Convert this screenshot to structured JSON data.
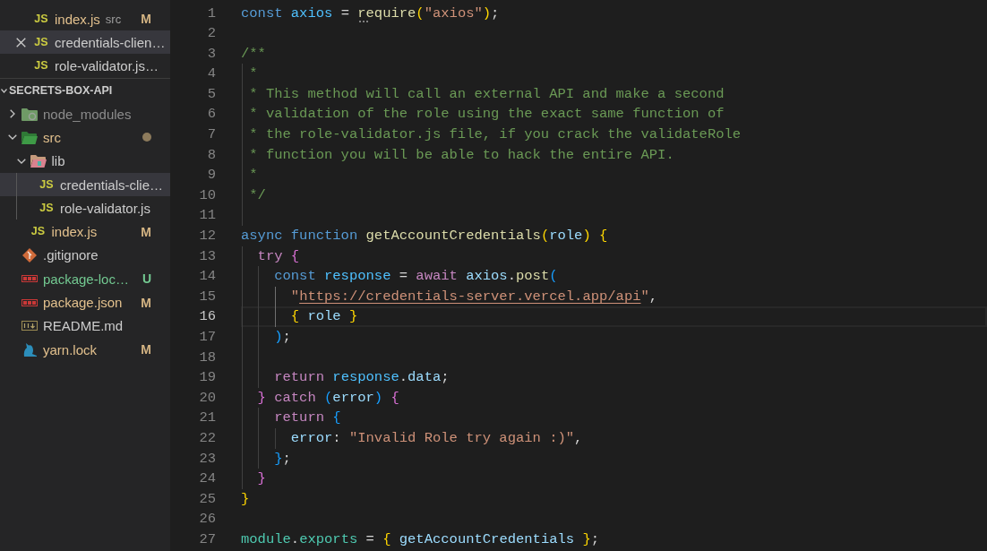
{
  "open_editors": [
    {
      "name": "index.js",
      "description": "src",
      "kind": "script",
      "icon_text": "JS",
      "selected": false,
      "decoration": {
        "kind": "modified",
        "badge": "M"
      }
    },
    {
      "name": "credentials-clien…",
      "kind": "script",
      "icon_text": "JS",
      "selected": true
    },
    {
      "name": "role-validator.js…",
      "kind": "script",
      "icon_text": "JS",
      "selected": false
    }
  ],
  "explorer": {
    "title": "SECRETS-BOX-API",
    "expanded": true,
    "items": [
      {
        "name": "node_modules",
        "kind": "modules",
        "expanded": false,
        "selected": false,
        "decoration": {
          "kind": "ignored"
        }
      },
      {
        "name": "src",
        "kind": "source",
        "expanded": true,
        "selected": false,
        "decoration": {
          "kind": "nested"
        },
        "children": [
          {
            "name": "lib",
            "kind": "library",
            "expanded": true,
            "selected": false,
            "children": [
              {
                "name": "credentials-clie…",
                "kind": "script",
                "icon_text": "JS",
                "selected": true
              },
              {
                "name": "role-validator.js",
                "kind": "script",
                "icon_text": "JS",
                "selected": false
              }
            ]
          },
          {
            "name": "index.js",
            "kind": "script",
            "icon_text": "JS",
            "selected": false,
            "decoration": {
              "kind": "modified",
              "badge": "M"
            }
          }
        ]
      },
      {
        "name": ".gitignore",
        "kind": "git",
        "selected": false
      },
      {
        "name": "package-loc…",
        "kind": "npm",
        "selected": false,
        "decoration": {
          "kind": "untracked",
          "badge": "U"
        }
      },
      {
        "name": "package.json",
        "kind": "npm",
        "selected": false,
        "decoration": {
          "kind": "modified",
          "badge": "M"
        }
      },
      {
        "name": "README.md",
        "kind": "markdown",
        "selected": false
      },
      {
        "name": "yarn.lock",
        "kind": "yarn",
        "selected": false,
        "decoration": {
          "kind": "modified",
          "badge": "M"
        }
      }
    ]
  },
  "code": {
    "lines": [
      {
        "number": "1",
        "current": false,
        "tokens": [
          {
            "text": "const ",
            "kind": "keyword"
          },
          {
            "text": "axios",
            "kind": "constant"
          },
          {
            "text": " = ",
            "kind": "plain"
          },
          {
            "text": "require",
            "kind": "function",
            "hint": true
          },
          {
            "text": "(",
            "kind": "bracket1"
          },
          {
            "text": "\"axios\"",
            "kind": "string"
          },
          {
            "text": ")",
            "kind": "bracket1"
          },
          {
            "text": ";",
            "kind": "plain"
          }
        ]
      },
      {
        "number": "2",
        "current": false
      },
      {
        "number": "3",
        "current": false,
        "tokens": [
          {
            "text": "/**",
            "kind": "comment"
          }
        ]
      },
      {
        "number": "4",
        "current": false,
        "guides": [
          {
            "active": false
          }
        ],
        "tokens": [
          {
            "text": " *",
            "kind": "comment"
          }
        ]
      },
      {
        "number": "5",
        "current": false,
        "guides": [
          {
            "active": false
          }
        ],
        "tokens": [
          {
            "text": " * This method will call an external API and make a second",
            "kind": "comment"
          }
        ]
      },
      {
        "number": "6",
        "current": false,
        "guides": [
          {
            "active": false
          }
        ],
        "tokens": [
          {
            "text": " * validation of the role using the exact same function of",
            "kind": "comment"
          }
        ]
      },
      {
        "number": "7",
        "current": false,
        "guides": [
          {
            "active": false
          }
        ],
        "tokens": [
          {
            "text": " * the role-validator.js file, if you crack the validateRole",
            "kind": "comment"
          }
        ]
      },
      {
        "number": "8",
        "current": false,
        "guides": [
          {
            "active": false
          }
        ],
        "tokens": [
          {
            "text": " * function you will be able to hack the entire API.",
            "kind": "comment"
          }
        ]
      },
      {
        "number": "9",
        "current": false,
        "guides": [
          {
            "active": false
          }
        ],
        "tokens": [
          {
            "text": " *",
            "kind": "comment"
          }
        ]
      },
      {
        "number": "10",
        "current": false,
        "guides": [
          {
            "active": false
          }
        ],
        "tokens": [
          {
            "text": " */",
            "kind": "comment"
          }
        ]
      },
      {
        "number": "11",
        "current": false,
        "guides": [
          {
            "active": false
          }
        ]
      },
      {
        "number": "12",
        "current": false,
        "tokens": [
          {
            "text": "async ",
            "kind": "keyword"
          },
          {
            "text": "function ",
            "kind": "keyword"
          },
          {
            "text": "getAccountCredentials",
            "kind": "function"
          },
          {
            "text": "(",
            "kind": "bracket1"
          },
          {
            "text": "role",
            "kind": "variable"
          },
          {
            "text": ") ",
            "kind": "bracket1"
          },
          {
            "text": "{",
            "kind": "bracket1"
          }
        ]
      },
      {
        "number": "13",
        "current": false,
        "guides": [
          {
            "active": false
          }
        ],
        "tokens": [
          {
            "text": "  try ",
            "kind": "control"
          },
          {
            "text": "{",
            "kind": "bracket2"
          }
        ]
      },
      {
        "number": "14",
        "current": false,
        "guides": [
          {
            "active": false
          },
          {
            "active": false
          }
        ],
        "tokens": [
          {
            "text": "    const ",
            "kind": "keyword"
          },
          {
            "text": "response",
            "kind": "constant"
          },
          {
            "text": " = ",
            "kind": "plain"
          },
          {
            "text": "await ",
            "kind": "control"
          },
          {
            "text": "axios",
            "kind": "variable"
          },
          {
            "text": ".",
            "kind": "plain"
          },
          {
            "text": "post",
            "kind": "function"
          },
          {
            "text": "(",
            "kind": "bracket3"
          }
        ]
      },
      {
        "number": "15",
        "current": false,
        "guides": [
          {
            "active": false
          },
          {
            "active": false
          },
          {
            "active": true
          }
        ],
        "tokens": [
          {
            "text": "      \"",
            "kind": "string"
          },
          {
            "text": "https://credentials-server.vercel.app/api",
            "kind": "link"
          },
          {
            "text": "\"",
            "kind": "string"
          },
          {
            "text": ",",
            "kind": "plain"
          }
        ]
      },
      {
        "number": "16",
        "current": true,
        "guides": [
          {
            "active": false
          },
          {
            "active": false
          },
          {
            "active": true
          }
        ],
        "tokens": [
          {
            "text": "      { ",
            "kind": "bracket1"
          },
          {
            "text": "role ",
            "kind": "variable"
          },
          {
            "text": "}",
            "kind": "bracket1"
          }
        ]
      },
      {
        "number": "17",
        "current": false,
        "guides": [
          {
            "active": false
          },
          {
            "active": false
          }
        ],
        "tokens": [
          {
            "text": "    )",
            "kind": "bracket3"
          },
          {
            "text": ";",
            "kind": "plain"
          }
        ]
      },
      {
        "number": "18",
        "current": false,
        "guides": [
          {
            "active": false
          },
          {
            "active": false
          }
        ]
      },
      {
        "number": "19",
        "current": false,
        "guides": [
          {
            "active": false
          },
          {
            "active": false
          }
        ],
        "tokens": [
          {
            "text": "    return ",
            "kind": "control"
          },
          {
            "text": "response",
            "kind": "constant"
          },
          {
            "text": ".",
            "kind": "plain"
          },
          {
            "text": "data",
            "kind": "variable"
          },
          {
            "text": ";",
            "kind": "plain"
          }
        ]
      },
      {
        "number": "20",
        "current": false,
        "guides": [
          {
            "active": false
          }
        ],
        "tokens": [
          {
            "text": "  } ",
            "kind": "bracket2"
          },
          {
            "text": "catch ",
            "kind": "control"
          },
          {
            "text": "(",
            "kind": "bracket3"
          },
          {
            "text": "error",
            "kind": "variable"
          },
          {
            "text": ") ",
            "kind": "bracket3"
          },
          {
            "text": "{",
            "kind": "bracket2"
          }
        ]
      },
      {
        "number": "21",
        "current": false,
        "guides": [
          {
            "active": false
          },
          {
            "active": false
          }
        ],
        "tokens": [
          {
            "text": "    return ",
            "kind": "control"
          },
          {
            "text": "{",
            "kind": "bracket3"
          }
        ]
      },
      {
        "number": "22",
        "current": false,
        "guides": [
          {
            "active": false
          },
          {
            "active": false
          },
          {
            "active": false
          }
        ],
        "tokens": [
          {
            "text": "      error",
            "kind": "variable"
          },
          {
            "text": ": ",
            "kind": "plain"
          },
          {
            "text": "\"Invalid Role try again :)\"",
            "kind": "string"
          },
          {
            "text": ",",
            "kind": "plain"
          }
        ]
      },
      {
        "number": "23",
        "current": false,
        "guides": [
          {
            "active": false
          },
          {
            "active": false
          }
        ],
        "tokens": [
          {
            "text": "    }",
            "kind": "bracket3"
          },
          {
            "text": ";",
            "kind": "plain"
          }
        ]
      },
      {
        "number": "24",
        "current": false,
        "guides": [
          {
            "active": false
          }
        ],
        "tokens": [
          {
            "text": "  }",
            "kind": "bracket2"
          }
        ]
      },
      {
        "number": "25",
        "current": false,
        "tokens": [
          {
            "text": "}",
            "kind": "bracket1"
          }
        ]
      },
      {
        "number": "26",
        "current": false
      },
      {
        "number": "27",
        "current": false,
        "tokens": [
          {
            "text": "module",
            "kind": "module"
          },
          {
            "text": ".",
            "kind": "plain"
          },
          {
            "text": "exports",
            "kind": "module"
          },
          {
            "text": " = ",
            "kind": "plain"
          },
          {
            "text": "{ ",
            "kind": "bracket1"
          },
          {
            "text": "getAccountCredentials ",
            "kind": "variable"
          },
          {
            "text": "}",
            "kind": "bracket1"
          },
          {
            "text": ";",
            "kind": "plain"
          }
        ]
      }
    ]
  }
}
